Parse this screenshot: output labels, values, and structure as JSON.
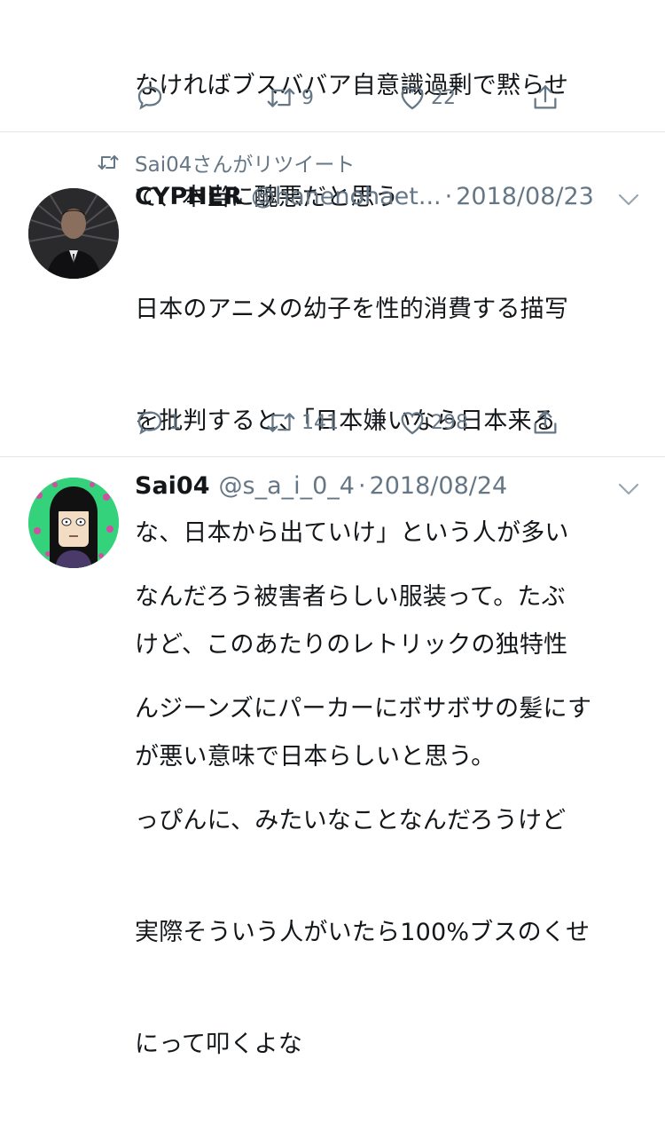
{
  "tweet0": {
    "text_lines": [
      "なければブスババア自意識過剰で黙らせ",
      "て、本当に醜悪だと思う"
    ],
    "retweets": "9",
    "likes": "22"
  },
  "retweet_banner": {
    "label": "Sai04さんがリツイート"
  },
  "tweet1": {
    "name": "CYPHER",
    "handle": "@hanenohaet...",
    "date": "2018/08/23",
    "text_lines": [
      "日本のアニメの幼子を性的消費する描写",
      "を批判すると、「日本嫌いなら日本来る",
      "な、日本から出ていけ」という人が多い",
      "けど、このあたりのレトリックの独特性",
      "が悪い意味で日本らしいと思う。"
    ],
    "replies": "1",
    "retweets": "141",
    "likes": "298"
  },
  "tweet2": {
    "name": "Sai04",
    "handle": "@s_a_i_0_4",
    "date": "2018/08/24",
    "text_lines": [
      "なんだろう被害者らしい服装って。たぶ",
      "んジーンズにパーカーにボサボサの髪にす",
      "っぴんに、みたいなことなんだろうけど",
      "実際そういう人がいたら100%ブスのくせ",
      "にって叩くよな"
    ]
  },
  "colors": {
    "text": "#14171a",
    "muted": "#657786",
    "divider": "#e1e8ed",
    "avatar2_bg": "#2ecc71"
  },
  "icons": [
    "reply-icon",
    "retweet-icon",
    "like-icon",
    "share-icon",
    "chevron-down-icon"
  ]
}
